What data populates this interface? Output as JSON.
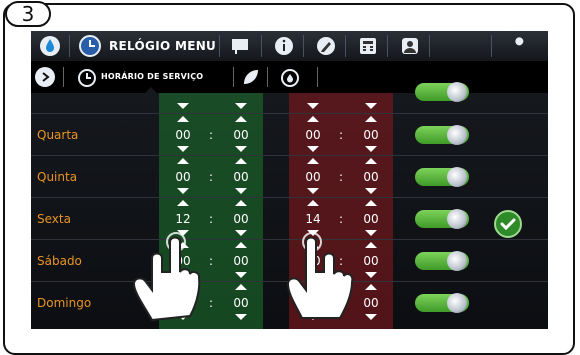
{
  "step_number": "3",
  "topbar": {
    "title": "RELÓGIO MENU",
    "icons": [
      "water-drop-icon",
      "clock-icon",
      "flag-icon",
      "info-icon",
      "pencil-icon",
      "calculator-icon",
      "user-icon",
      "wrench-icon"
    ]
  },
  "subbar": {
    "label": "HORÁRIO DE SERVIÇO",
    "icons": [
      "arrow-right-icon",
      "service-clock-icon",
      "leaf-icon",
      "clock-drop-icon"
    ]
  },
  "schedule": [
    {
      "day": "",
      "start_h": "",
      "start_m": "",
      "end_h": "",
      "end_m": "",
      "enabled": true
    },
    {
      "day": "Quarta",
      "start_h": "00",
      "start_m": "00",
      "end_h": "00",
      "end_m": "00",
      "enabled": true
    },
    {
      "day": "Quinta",
      "start_h": "00",
      "start_m": "00",
      "end_h": "00",
      "end_m": "00",
      "enabled": true
    },
    {
      "day": "Sexta",
      "start_h": "12",
      "start_m": "00",
      "end_h": "14",
      "end_m": "00",
      "enabled": true
    },
    {
      "day": "Sábado",
      "start_h": "00",
      "start_m": "00",
      "end_h": "00",
      "end_m": "00",
      "enabled": true
    },
    {
      "day": "Domingo",
      "start_h": "00",
      "start_m": "00",
      "end_h": "00",
      "end_m": "00",
      "enabled": true
    }
  ],
  "separator": ":",
  "colors": {
    "day_label": "#e89422",
    "start_zone": "#1e782d",
    "end_zone": "#8c191e",
    "toggle_on": "#5cb83a"
  },
  "confirm_icon": "checkmark-icon"
}
